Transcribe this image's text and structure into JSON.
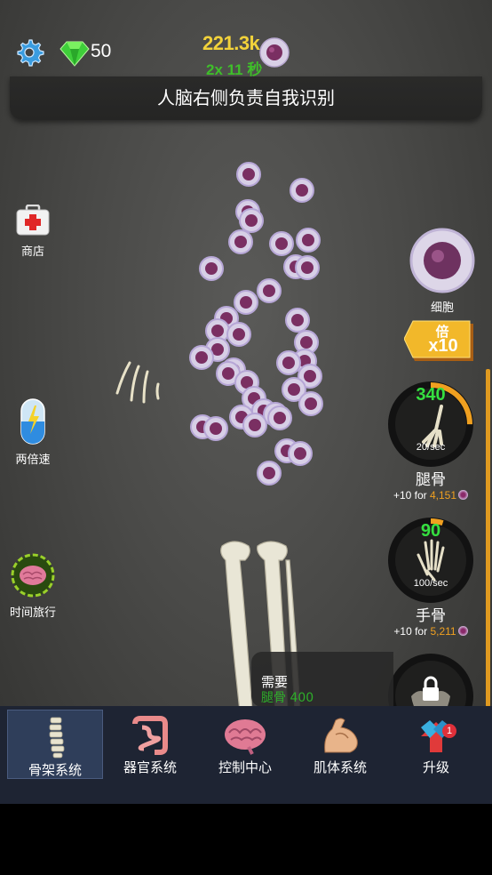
{
  "top_bar": {
    "gems": "50",
    "cells_total": "221.3k",
    "boost_timer": "2x 11 秒"
  },
  "fact_banner": "人脑右侧负责自我识别",
  "left_buttons": {
    "shop": "商店",
    "double_speed": "两倍速",
    "time_travel": "时间旅行"
  },
  "right_panel": {
    "cell_label": "细胞",
    "multiplier_top": "倍",
    "multiplier_value": "x10",
    "upgrades": [
      {
        "name": "腿骨",
        "count": "340",
        "rate": "20/sec",
        "cost_prefix": "+10 for ",
        "cost": "4,151",
        "progress": 0.25
      },
      {
        "name": "手骨",
        "count": "90",
        "rate": "100/sec",
        "cost_prefix": "+10 for ",
        "cost": "5,211",
        "progress": 0.05
      }
    ]
  },
  "need_tooltip": {
    "title": "需要",
    "requirement": "腿骨 400"
  },
  "bottom_nav": [
    {
      "label": "骨架系统",
      "icon": "spine-icon",
      "active": true
    },
    {
      "label": "器官系统",
      "icon": "intestine-icon",
      "active": false
    },
    {
      "label": "控制中心",
      "icon": "brain-icon",
      "active": false
    },
    {
      "label": "肌体系统",
      "icon": "arm-muscle-icon",
      "active": false
    },
    {
      "label": "升级",
      "icon": "upgrade-arrow-icon",
      "active": false,
      "badge": "1"
    }
  ],
  "colors": {
    "gold": "#f2d23a",
    "green": "#35e040",
    "orange": "#f0a020",
    "nav_bg": "#1e2433",
    "nav_active": "#2f3e5a"
  }
}
